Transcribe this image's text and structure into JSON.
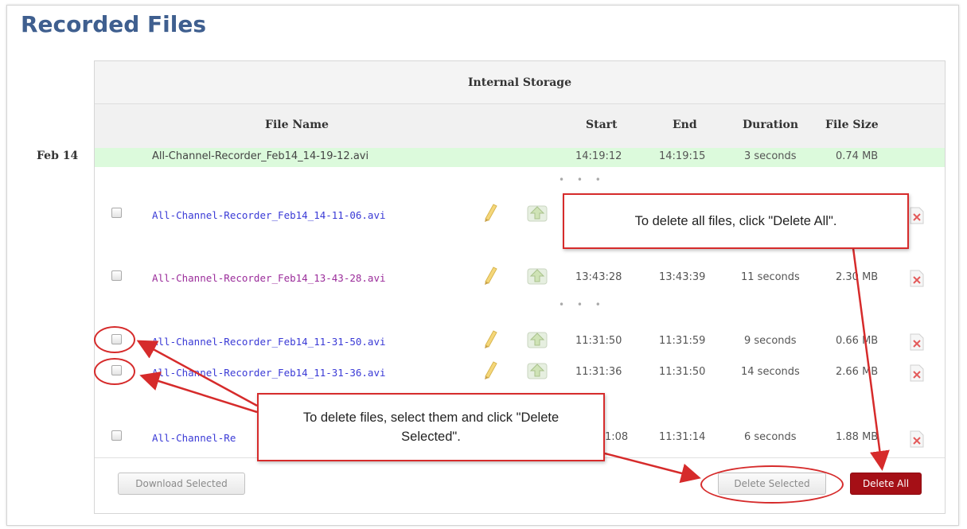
{
  "page": {
    "title": "Recorded Files"
  },
  "storage": {
    "header": "Internal Storage"
  },
  "columns": {
    "file_name": "File Name",
    "start": "Start",
    "end": "End",
    "duration": "Duration",
    "file_size": "File Size"
  },
  "groups": [
    {
      "date": "Feb 14"
    }
  ],
  "current_recording": {
    "name": "All-Channel-Recorder_Feb14_14-19-12.avi",
    "start": "14:19:12",
    "end": "14:19:15",
    "duration": "3 seconds",
    "size": "0.74 MB"
  },
  "files": [
    {
      "name": "All-Channel-Recorder_Feb14_14-11-06.avi",
      "start": "",
      "end": "",
      "duration": "",
      "size": ""
    },
    {
      "name": "All-Channel-Recorder_Feb14_13-43-28.avi",
      "start": "13:43:28",
      "end": "13:43:39",
      "duration": "11 seconds",
      "size": "2.30 MB"
    },
    {
      "name": "All-Channel-Recorder_Feb14_11-31-50.avi",
      "start": "11:31:50",
      "end": "11:31:59",
      "duration": "9 seconds",
      "size": "0.66 MB"
    },
    {
      "name": "All-Channel-Recorder_Feb14_11-31-36.avi",
      "start": "11:31:36",
      "end": "11:31:50",
      "duration": "14 seconds",
      "size": "2.66 MB"
    },
    {
      "name": "All-Channel-Re",
      "start": "1:08",
      "end": "11:31:14",
      "duration": "6 seconds",
      "size": "1.88 MB"
    }
  ],
  "separator": "• • •",
  "buttons": {
    "download_selected": "Download Selected",
    "delete_selected": "Delete Selected",
    "delete_all": "Delete All"
  },
  "callouts": {
    "delete_all": "To delete all files, click \"Delete All\".",
    "delete_selected_line1": "To delete files, select them and click \"Delete",
    "delete_selected_line2": "Selected\"."
  },
  "icons": {
    "rename": "pencil-icon",
    "upload": "upload-arrow-icon",
    "delete": "delete-file-icon"
  },
  "colors": {
    "title": "#3f5f8f",
    "current_row": "#dcfadc",
    "link_blue": "#3a3ad6",
    "link_visited": "#9b2d9b",
    "delete_all_button": "#a50f16",
    "annotation": "#d62b2b"
  }
}
